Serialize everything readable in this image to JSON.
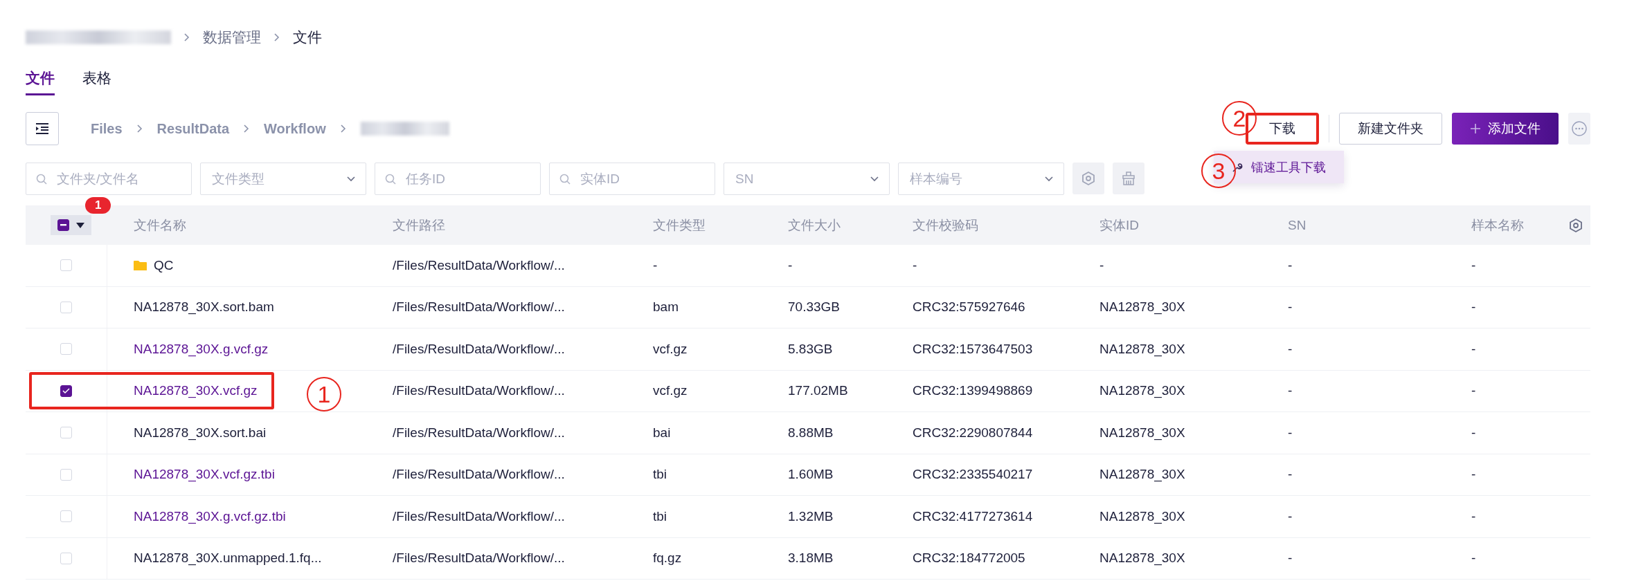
{
  "breadcrumb": [
    {
      "kind": "redacted"
    },
    {
      "kind": "text",
      "text": "数据管理",
      "current": false
    },
    {
      "kind": "text",
      "text": "文件",
      "current": true
    }
  ],
  "tabs": [
    {
      "label": "文件",
      "selected": true
    },
    {
      "label": "表格",
      "selected": false
    }
  ],
  "path": [
    {
      "kind": "text",
      "text": "Files"
    },
    {
      "kind": "text",
      "text": "ResultData"
    },
    {
      "kind": "text",
      "text": "Workflow"
    },
    {
      "kind": "redacted"
    }
  ],
  "actions": [
    {
      "kind": "plain",
      "label": "下载",
      "annotated": true
    },
    {
      "kind": "outline",
      "label": "新建文件夹",
      "annotated": false
    },
    {
      "kind": "primary",
      "label": "添加文件",
      "annotated": false
    },
    {
      "kind": "more",
      "annotated": false
    }
  ],
  "menu": {
    "items": [
      {
        "label": "镭速工具下载"
      }
    ]
  },
  "filters": [
    {
      "kind": "search",
      "placeholder": "文件夹/文件名"
    },
    {
      "kind": "select",
      "placeholder": "文件类型"
    },
    {
      "kind": "search",
      "placeholder": "任务ID"
    },
    {
      "kind": "search",
      "placeholder": "实体ID"
    },
    {
      "kind": "select",
      "placeholder": "SN"
    },
    {
      "kind": "select",
      "placeholder": "样本编号"
    }
  ],
  "table": {
    "select_all_partial": true,
    "selected_count": "1",
    "columns": [
      "文件名称",
      "文件路径",
      "文件类型",
      "文件大小",
      "文件校验码",
      "实体ID",
      "SN",
      "样本名称"
    ],
    "rows": [
      {
        "kind": "folder",
        "checked": false,
        "annotated": false,
        "color": "#1d1f3a",
        "cells": [
          "QC",
          "/Files/ResultData/Workflow/...",
          "-",
          "-",
          "-",
          "-",
          "-",
          "-"
        ]
      },
      {
        "kind": "file",
        "checked": false,
        "annotated": false,
        "color": "#1d1f3a",
        "cells": [
          "NA12878_30X.sort.bam",
          "/Files/ResultData/Workflow/...",
          "bam",
          "70.33GB",
          "CRC32:575927646",
          "NA12878_30X",
          "-",
          "-"
        ]
      },
      {
        "kind": "file",
        "checked": false,
        "annotated": false,
        "color": "#5b1394",
        "cells": [
          "NA12878_30X.g.vcf.gz",
          "/Files/ResultData/Workflow/...",
          "vcf.gz",
          "5.83GB",
          "CRC32:1573647503",
          "NA12878_30X",
          "-",
          "-"
        ]
      },
      {
        "kind": "file",
        "checked": true,
        "annotated": true,
        "color": "#5b1394",
        "cells": [
          "NA12878_30X.vcf.gz",
          "/Files/ResultData/Workflow/...",
          "vcf.gz",
          "177.02MB",
          "CRC32:1399498869",
          "NA12878_30X",
          "-",
          "-"
        ]
      },
      {
        "kind": "file",
        "checked": false,
        "annotated": false,
        "color": "#1d1f3a",
        "cells": [
          "NA12878_30X.sort.bai",
          "/Files/ResultData/Workflow/...",
          "bai",
          "8.88MB",
          "CRC32:2290807844",
          "NA12878_30X",
          "-",
          "-"
        ]
      },
      {
        "kind": "file",
        "checked": false,
        "annotated": false,
        "color": "#5b1394",
        "cells": [
          "NA12878_30X.vcf.gz.tbi",
          "/Files/ResultData/Workflow/...",
          "tbi",
          "1.60MB",
          "CRC32:2335540217",
          "NA12878_30X",
          "-",
          "-"
        ]
      },
      {
        "kind": "file",
        "checked": false,
        "annotated": false,
        "color": "#5b1394",
        "cells": [
          "NA12878_30X.g.vcf.gz.tbi",
          "/Files/ResultData/Workflow/...",
          "tbi",
          "1.32MB",
          "CRC32:4177273614",
          "NA12878_30X",
          "-",
          "-"
        ]
      },
      {
        "kind": "file",
        "checked": false,
        "annotated": false,
        "color": "#1d1f3a",
        "cells": [
          "NA12878_30X.unmapped.1.fq...",
          "/Files/ResultData/Workflow/...",
          "fq.gz",
          "3.18MB",
          "CRC32:184772005",
          "NA12878_30X",
          "-",
          "-"
        ]
      }
    ]
  },
  "annotations": [
    {
      "label": "1"
    },
    {
      "label": "2"
    },
    {
      "label": "3"
    }
  ]
}
